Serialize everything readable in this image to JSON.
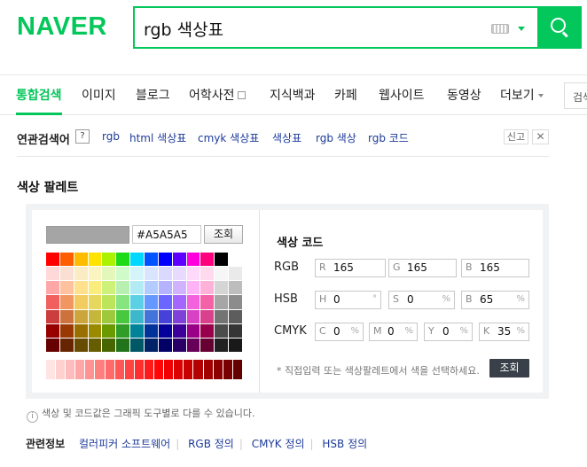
{
  "header": {
    "logo": "NAVER",
    "search_value": "rgb 색상표",
    "colors": {
      "brand": "#03c75a"
    }
  },
  "tabs": [
    "통합검색",
    "이미지",
    "블로그",
    "어학사전",
    "지식백과",
    "카페",
    "웹사이트",
    "동영상",
    "더보기",
    "검색"
  ],
  "related": {
    "title": "연관검색어",
    "help": "?",
    "items": [
      "rgb",
      "html 색상표",
      "cmyk 색상표",
      "색상표",
      "rgb 색상",
      "rgb 코드"
    ],
    "report": "신고",
    "close": "✕"
  },
  "palette": {
    "title": "색상 팔레트",
    "hex_value": "#A5A5A5",
    "preview_color": "#a5a5a5",
    "lookup_button": "조회",
    "code_title": "색상 코드",
    "rgb": {
      "label": "RGB",
      "r_label": "R",
      "r": "165",
      "g_label": "G",
      "g": "165",
      "b_label": "B",
      "b": "165"
    },
    "hsb": {
      "label": "HSB",
      "h_label": "H",
      "h": "0",
      "h_unit": "°",
      "s_label": "S",
      "s": "0",
      "s_unit": "%",
      "b_label": "B",
      "b": "65",
      "b_unit": "%"
    },
    "cmyk": {
      "label": "CMYK",
      "c_label": "C",
      "c": "0",
      "m_label": "M",
      "m": "0",
      "y_label": "Y",
      "y": "0",
      "k_label": "K",
      "k": "35",
      "unit": "%"
    },
    "help_text": "* 직접입력 또는 색상팔레트에서 색을 선택하세요.",
    "submit_button": "조회",
    "swatches": [
      [
        "#ff0000",
        "#ff5e00",
        "#ffbb00",
        "#ffe400",
        "#abf200",
        "#1ddb16",
        "#00d8ff",
        "#0054ff",
        "#0100ff",
        "#5f00ff",
        "#ff00dd",
        "#ff007f",
        "#000000",
        "#ffffff"
      ],
      [
        "#ffd8d8",
        "#fae0d4",
        "#faecc5",
        "#faf4c0",
        "#e4f7ba",
        "#cefbc9",
        "#d4f4fa",
        "#d9e5ff",
        "#dad9ff",
        "#e8d9ff",
        "#ffd9fa",
        "#ffd9ec",
        "#f6f6f6",
        "#eaeaea"
      ],
      [
        "#ffa7a7",
        "#ffc19e",
        "#ffe08c",
        "#faed7d",
        "#cef279",
        "#b7f0b1",
        "#b2ebf4",
        "#b2ccff",
        "#b5b2ff",
        "#d1b2ff",
        "#ffb2f5",
        "#ffb2d9",
        "#d5d5d5",
        "#bdbdbd"
      ],
      [
        "#f15f5f",
        "#f29661",
        "#f2cb61",
        "#e5d85c",
        "#bce55c",
        "#86e57f",
        "#5cd1e5",
        "#6699ff",
        "#6b66ff",
        "#a566ff",
        "#f361dc",
        "#f361a6",
        "#a6a6a6",
        "#8c8c8c"
      ],
      [
        "#cc3d3d",
        "#cc723d",
        "#cca63d",
        "#c4b73b",
        "#9fc93c",
        "#47c83e",
        "#3db7cc",
        "#4374d9",
        "#4641d9",
        "#8041d9",
        "#d941c5",
        "#d9418c",
        "#747474",
        "#5d5d5d"
      ],
      [
        "#980000",
        "#993800",
        "#997000",
        "#998a00",
        "#6b9900",
        "#2f9d27",
        "#008299",
        "#003399",
        "#050099",
        "#3d0099",
        "#990085",
        "#99004c",
        "#4c4c4c",
        "#353535"
      ],
      [
        "#670000",
        "#662500",
        "#664b00",
        "#665c00",
        "#476600",
        "#22741c",
        "#005766",
        "#002266",
        "#030066",
        "#290066",
        "#660058",
        "#660033",
        "#212121",
        "#191919"
      ]
    ],
    "gradient": [
      "#ffe4e4",
      "#ffd0d0",
      "#ffbcbc",
      "#ffa7a7",
      "#ff9393",
      "#ff7f7f",
      "#ff6a6a",
      "#ff5656",
      "#ff4242",
      "#ff2d2d",
      "#ff1919",
      "#ff0505",
      "#f00000",
      "#dc0000",
      "#c80000",
      "#b40000",
      "#a00000",
      "#8c0000",
      "#780000",
      "#640000"
    ]
  },
  "note": "색상 및 코드값은 그래픽 도구별로 다를 수 있습니다.",
  "related_info": {
    "title": "관련정보",
    "links": [
      "컬러피커 소프트웨어",
      "RGB 정의",
      "CMYK 정의",
      "HSB 정의"
    ]
  }
}
